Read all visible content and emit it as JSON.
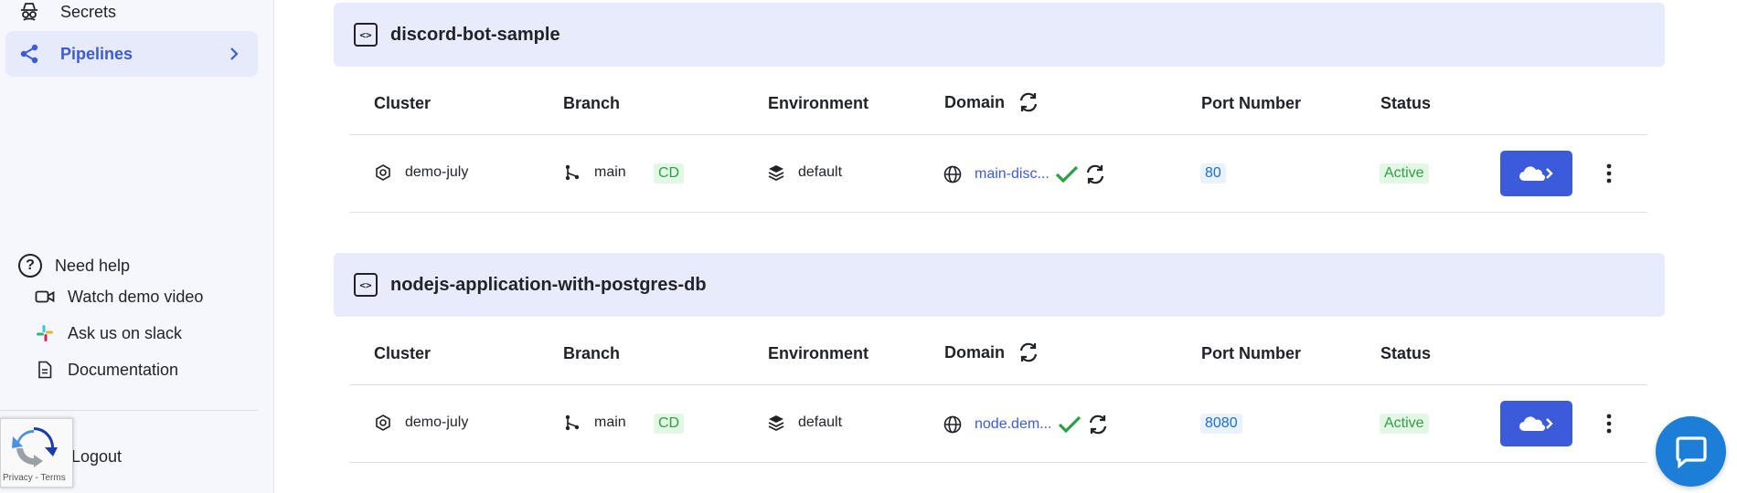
{
  "sidebar": {
    "items": [
      {
        "label": "Secrets",
        "icon": "secrets-icon"
      },
      {
        "label": "Pipelines",
        "icon": "share-nodes-icon",
        "active": true
      }
    ],
    "help": {
      "title": "Need help",
      "items": [
        {
          "label": "Watch demo video",
          "icon": "video-icon"
        },
        {
          "label": "Ask us on slack",
          "icon": "slack-icon"
        },
        {
          "label": "Documentation",
          "icon": "document-icon"
        }
      ]
    },
    "logout_label": "Logout"
  },
  "recaptcha": {
    "terms": "Privacy - Terms"
  },
  "columns": {
    "cluster": "Cluster",
    "branch": "Branch",
    "environment": "Environment",
    "domain": "Domain",
    "port": "Port Number",
    "status": "Status"
  },
  "pipelines": [
    {
      "name": "discord-bot-sample",
      "cluster": "demo-july",
      "branch": "main",
      "cd_tag": "CD",
      "environment": "default",
      "domain": "main-disc...",
      "port": "80",
      "status": "Active"
    },
    {
      "name": "nodejs-application-with-postgres-db",
      "cluster": "demo-july",
      "branch": "main",
      "cd_tag": "CD",
      "environment": "default",
      "domain": "node.dem...",
      "port": "8080",
      "status": "Active"
    }
  ],
  "colors": {
    "accent": "#3b5bdb",
    "sidebar_bg": "#f5f7fd",
    "card_head_bg": "#e8ebfc",
    "status_green": "#2f9e44",
    "chat_blue": "#1c7ed6"
  }
}
